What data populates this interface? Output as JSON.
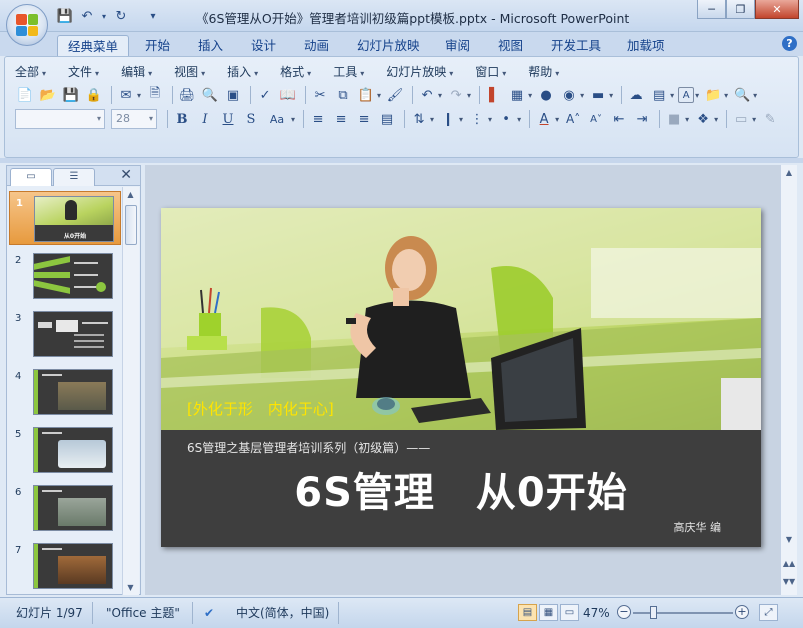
{
  "window": {
    "title": "《6S管理从O开始》管理者培训初级篇ppt模板.pptx - Microsoft PowerPoint",
    "controls": [
      "minimize-icon",
      "maximize-icon",
      "close-icon"
    ]
  },
  "quick_access": [
    "save-icon",
    "undo-icon",
    "redo-icon",
    "customize-icon"
  ],
  "ribbon_tabs": [
    "经典菜单",
    "开始",
    "插入",
    "设计",
    "动画",
    "幻灯片放映",
    "审阅",
    "视图",
    "开发工具",
    "加载项"
  ],
  "classic_menu": [
    "全部",
    "文件",
    "编辑",
    "视图",
    "插入",
    "格式",
    "工具",
    "幻灯片放映",
    "窗口",
    "帮助"
  ],
  "format": {
    "font_name": "",
    "font_size": "28"
  },
  "pane": {
    "tabs": [
      "slides-tab",
      "outline-tab"
    ],
    "thumbnails": [
      {
        "num": "1",
        "selected": true
      },
      {
        "num": "2",
        "selected": false
      },
      {
        "num": "3",
        "selected": false
      },
      {
        "num": "4",
        "selected": false
      },
      {
        "num": "5",
        "selected": false
      },
      {
        "num": "6",
        "selected": false
      },
      {
        "num": "7",
        "selected": false
      }
    ],
    "thumb1_title": "从0开始"
  },
  "slide": {
    "slogan": "[外化于形　内化于心]",
    "subtitle": "6S管理之基层管理者培训系列（初级篇）——",
    "title": "6S管理　从0开始",
    "author": "高庆华 编"
  },
  "status": {
    "slide_counter": "幻灯片 1/97",
    "theme": "\"Office 主题\"",
    "language": "中文(简体，中国)",
    "zoom": "47%",
    "zoom_level": 0.47
  },
  "colors": {
    "accent_yellow": "#ffe400",
    "slide_bg": "#3d3d3d",
    "selected_thumb": "#e79a3e"
  }
}
